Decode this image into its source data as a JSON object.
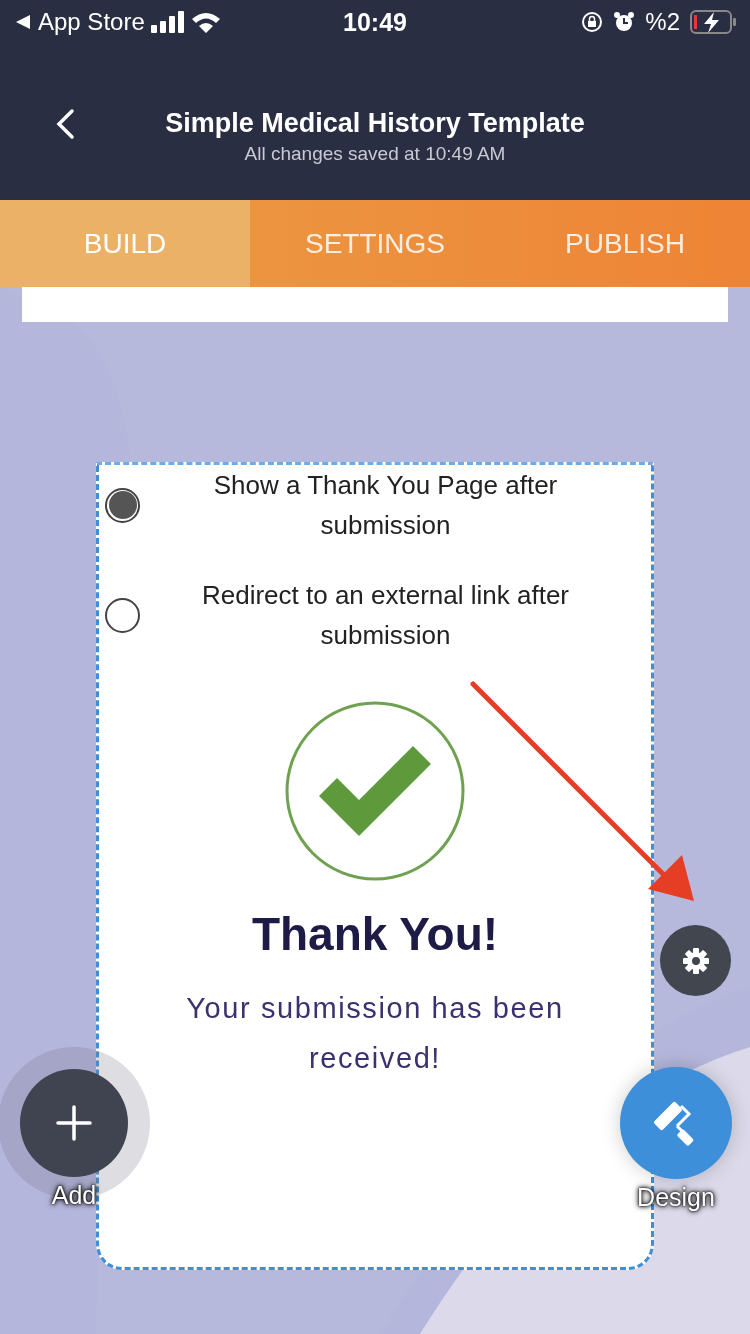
{
  "status_bar": {
    "back_label": "App Store",
    "time": "10:49",
    "battery": "%2"
  },
  "header": {
    "title": "Simple Medical History Template",
    "subtitle": "All changes saved at 10:49 AM"
  },
  "tabs": [
    {
      "label": "BUILD",
      "selected": true
    },
    {
      "label": "SETTINGS",
      "selected": false
    },
    {
      "label": "PUBLISH",
      "selected": false
    }
  ],
  "options": [
    {
      "label": "Show a Thank You Page after submission",
      "selected": true
    },
    {
      "label": "Redirect to an external link after submission",
      "selected": false
    }
  ],
  "thank_you": {
    "heading": "Thank You!",
    "message": "Your submission has been received!"
  },
  "buttons": [
    {
      "kind": "add",
      "label": "Add"
    },
    {
      "kind": "design",
      "label": "Design"
    }
  ]
}
